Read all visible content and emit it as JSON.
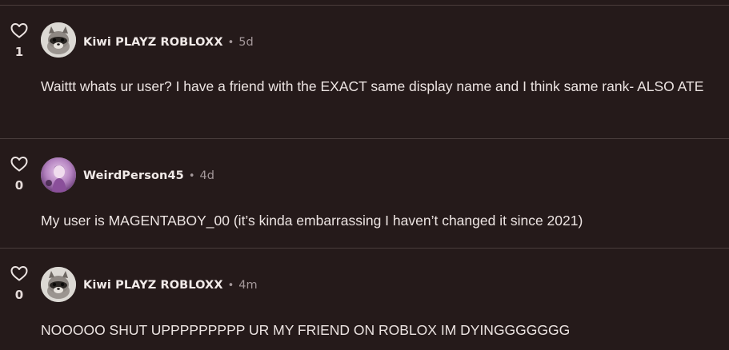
{
  "colors": {
    "background": "#251a1a",
    "divider": "#4a3d3c",
    "text": "#ece4e2",
    "muted": "#a4989a"
  },
  "comments": [
    {
      "likes": "1",
      "like_icon": "heart-outline-icon",
      "username": "Kiwi PLAYZ ROBLOXX",
      "separator": "•",
      "time": "5d",
      "avatar": "raccoon-avatar",
      "text": "Waittt whats ur user? I have a friend with the EXACT same display name and I think same rank- ALSO ATE"
    },
    {
      "likes": "0",
      "like_icon": "heart-outline-icon",
      "username": "WeirdPerson45",
      "separator": "•",
      "time": "4d",
      "avatar": "purple-character-avatar",
      "text": "My user is MAGENTABOY_00 (it’s kinda embarrassing I haven’t changed it since 2021)"
    },
    {
      "likes": "0",
      "like_icon": "heart-outline-icon",
      "username": "Kiwi PLAYZ ROBLOXX",
      "separator": "•",
      "time": "4m",
      "avatar": "raccoon-avatar",
      "text": "NOOOOO SHUT UPPPPPPPPP UR MY FRIEND ON ROBLOX IM DYINGGGGGGG"
    }
  ]
}
